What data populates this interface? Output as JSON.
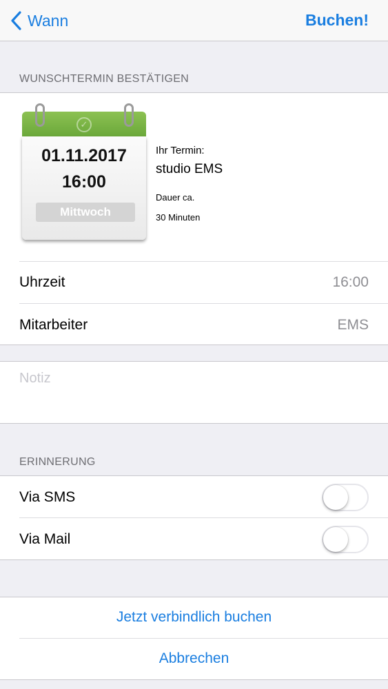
{
  "nav": {
    "back_label": "Wann",
    "book_label": "Buchen!"
  },
  "confirm_section": {
    "header": "WUNSCHTERMIN BESTÄTIGEN"
  },
  "calendar": {
    "date": "01.11.2017",
    "time": "16:00",
    "weekday": "Mittwoch"
  },
  "appointment": {
    "label": "Ihr Termin:",
    "name": "studio EMS",
    "duration_label": "Dauer ca.",
    "duration_value": "30 Minuten"
  },
  "details": [
    {
      "label": "Uhrzeit",
      "value": "16:00"
    },
    {
      "label": "Mitarbeiter",
      "value": "EMS"
    }
  ],
  "note": {
    "placeholder": "Notiz"
  },
  "reminder": {
    "header": "ERINNERUNG",
    "options": [
      {
        "label": "Via SMS",
        "enabled": false
      },
      {
        "label": "Via Mail",
        "enabled": false
      }
    ]
  },
  "actions": {
    "confirm_label": "Jetzt verbindlich buchen",
    "cancel_label": "Abbrechen"
  },
  "colors": {
    "accent": "#1a7ee0",
    "calendar_green": "#7cb342",
    "background": "#efeff4"
  }
}
